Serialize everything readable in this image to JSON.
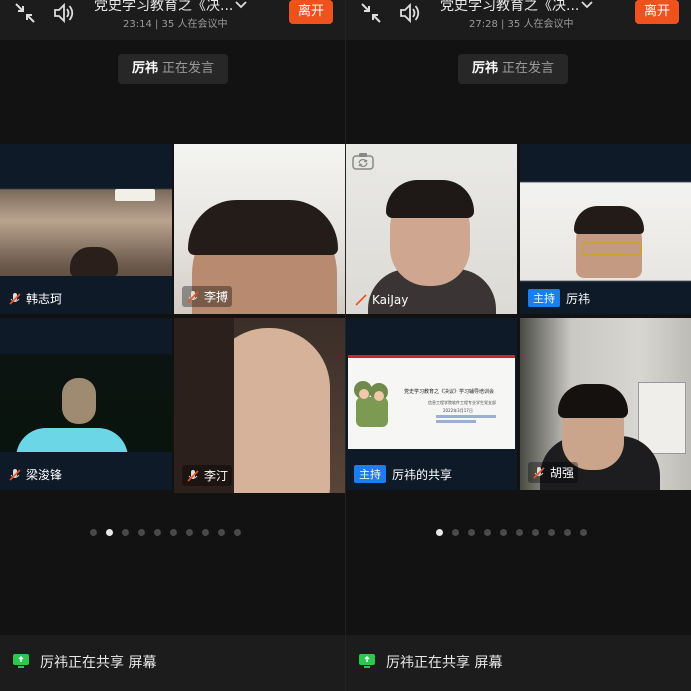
{
  "colors": {
    "accent": "#f0521e",
    "active_border": "#23c24a",
    "host_badge": "#1a7df0",
    "screen_icon": "#2bc84f"
  },
  "left": {
    "title": "党史学习教育之《决...",
    "subtitle": "23:14 | 35 人在会议中",
    "leave_label": "离开",
    "speaker_name": "厉祎",
    "speaker_status": "正在发言",
    "tiles": [
      {
        "name": "韩志珂",
        "muted": true
      },
      {
        "name": "李搏",
        "muted": true
      },
      {
        "name": "梁浚锋",
        "muted": true
      },
      {
        "name": "李汀",
        "muted": true
      }
    ],
    "page_dots": 10,
    "active_dot": 2,
    "share_status": "厉祎正在共享 屏幕"
  },
  "right": {
    "title": "党史学习教育之《决...",
    "subtitle": "27:28 | 35 人在会议中",
    "leave_label": "离开",
    "speaker_name": "厉祎",
    "speaker_status": "正在发言",
    "tiles": [
      {
        "name": "KaiJay",
        "muted": true
      },
      {
        "name": "厉祎",
        "host_badge": "主持",
        "active": true
      },
      {
        "name": "厉祎的共享",
        "host_badge": "主持",
        "active": true
      },
      {
        "name": "胡强",
        "muted": true
      }
    ],
    "share_slide": {
      "title": "党史学习教育之《决议》学习辅导培训会",
      "line1": "信息工程学院软件工程专业学生党支部",
      "line2": "2022年3月17日"
    },
    "page_dots": 10,
    "active_dot": 1,
    "share_status": "厉祎正在共享 屏幕"
  },
  "icons": [
    "shrink-icon",
    "speaker-icon",
    "chevron-down-icon",
    "mic-muted-icon",
    "screen-share-icon",
    "camera-switch-icon"
  ]
}
